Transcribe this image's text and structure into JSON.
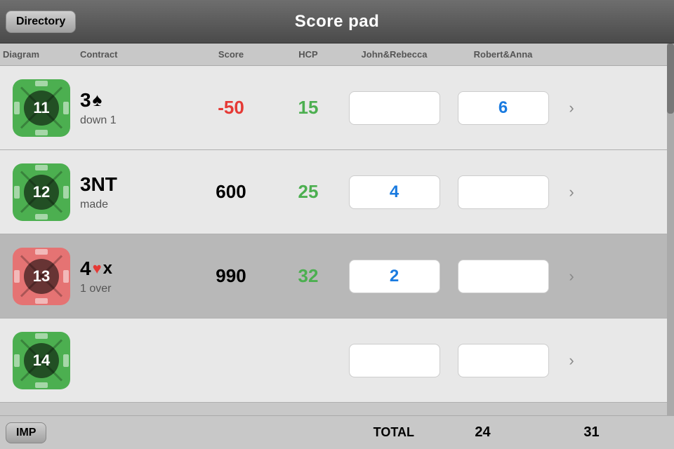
{
  "header": {
    "title": "Score pad",
    "directory_label": "Directory"
  },
  "columns": {
    "diagram": "Diagram",
    "contract": "Contract",
    "score": "Score",
    "hcp": "HCP",
    "john": "John&Rebecca",
    "robert": "Robert&Anna"
  },
  "rows": [
    {
      "id": 11,
      "color": "green",
      "contract_main": "3",
      "contract_suit": "♠",
      "contract_suit_type": "spade",
      "contract_sub": "down 1",
      "score": "-50",
      "score_type": "neg",
      "hcp": "15",
      "john_val": "",
      "robert_val": "6",
      "bg": "white"
    },
    {
      "id": 12,
      "color": "green",
      "contract_main": "3NT",
      "contract_suit": "",
      "contract_suit_type": "",
      "contract_sub": "made",
      "score": "600",
      "score_type": "pos",
      "hcp": "25",
      "john_val": "4",
      "robert_val": "",
      "bg": "white"
    },
    {
      "id": 13,
      "color": "red",
      "contract_main": "4",
      "contract_suit": "♥",
      "contract_suit_type": "heart",
      "contract_extra": "x",
      "contract_sub": "1 over",
      "score": "990",
      "score_type": "pos",
      "hcp": "32",
      "john_val": "2",
      "robert_val": "",
      "bg": "gray"
    },
    {
      "id": 14,
      "color": "green",
      "contract_main": "",
      "contract_suit": "",
      "contract_suit_type": "",
      "contract_sub": "",
      "score": "",
      "score_type": "",
      "hcp": "",
      "john_val": "",
      "robert_val": "",
      "bg": "white"
    }
  ],
  "footer": {
    "imp_label": "IMP",
    "total_label": "TOTAL",
    "john_total": "24",
    "robert_total": "31"
  }
}
